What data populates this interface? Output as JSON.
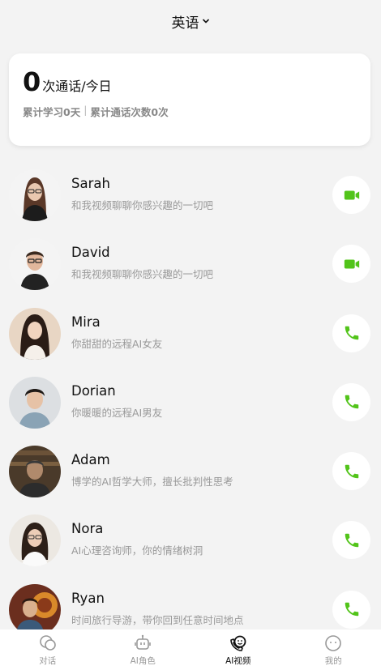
{
  "header": {
    "language": "英语"
  },
  "stats": {
    "call_count": "0",
    "call_count_label": "次通话/今日",
    "study_days": "累计学习0天",
    "separator": "|",
    "total_calls": "累计通话次数0次"
  },
  "contacts": [
    {
      "name": "Sarah",
      "desc": "和我视频聊聊你感兴趣的一切吧",
      "call_type": "video"
    },
    {
      "name": "David",
      "desc": "和我视频聊聊你感兴趣的一切吧",
      "call_type": "video"
    },
    {
      "name": "Mira",
      "desc": "你甜甜的远程AI女友",
      "call_type": "phone"
    },
    {
      "name": "Dorian",
      "desc": "你暖暖的远程AI男友",
      "call_type": "phone"
    },
    {
      "name": "Adam",
      "desc": "博学的AI哲学大师，擅长批判性思考",
      "call_type": "phone"
    },
    {
      "name": "Nora",
      "desc": "AI心理咨询师，你的情绪树洞",
      "call_type": "phone"
    },
    {
      "name": "Ryan",
      "desc": "时间旅行导游，带你回到任意时间地点",
      "call_type": "phone"
    }
  ],
  "tabs": [
    {
      "label": "对话",
      "icon": "chat-icon"
    },
    {
      "label": "AI角色",
      "icon": "robot-icon"
    },
    {
      "label": "AI视频",
      "icon": "video-call-icon",
      "active": true
    },
    {
      "label": "我的",
      "icon": "profile-icon"
    }
  ],
  "colors": {
    "accent": "#52c41a",
    "background": "#f3f3f3"
  }
}
